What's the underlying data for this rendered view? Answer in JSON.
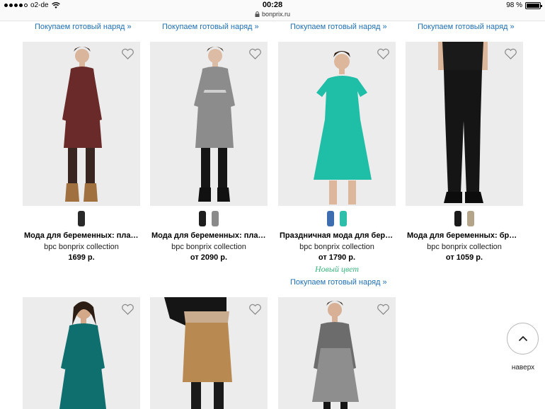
{
  "status_bar": {
    "carrier": "o2-de",
    "time": "00:28",
    "url": "bonprix.ru",
    "battery": "98 %",
    "battery_level": 0.98
  },
  "outfit_link_label": "Покупаем готовый наряд »",
  "products_row1": [
    {
      "name": "Мода для беременных: плат…",
      "brand": "bpc bonprix collection",
      "price": "1699 р.",
      "swatches": [
        "#2a2a2a"
      ],
      "dress_color": "#6b2a2a"
    },
    {
      "name": "Мода для беременных: плат…",
      "brand": "bpc bonprix collection",
      "price": "от 2090 р.",
      "swatches": [
        "#1e1e1e",
        "#8a8a8a"
      ],
      "dress_color": "#8c8c8c"
    },
    {
      "name": "Праздничная мода для бере…",
      "brand": "bpc bonprix collection",
      "price": "от 1790 р.",
      "swatches": [
        "#3e6eb0",
        "#2dbfa9"
      ],
      "new_color": "Новый цвет",
      "dress_color": "#1fbea6"
    },
    {
      "name": "Мода для беременных: брюк…",
      "brand": "bpc bonprix collection",
      "price": "от 1059 р.",
      "swatches": [
        "#1a1a1a",
        "#b4a48a"
      ],
      "dress_color": "#151515"
    }
  ],
  "products_row2": [
    {
      "dress_color": "#0f6f6f"
    },
    {
      "dress_color": "#b88a52"
    },
    {
      "dress_color": "#8e8e8e"
    }
  ],
  "back_to_top_label": "наверх"
}
